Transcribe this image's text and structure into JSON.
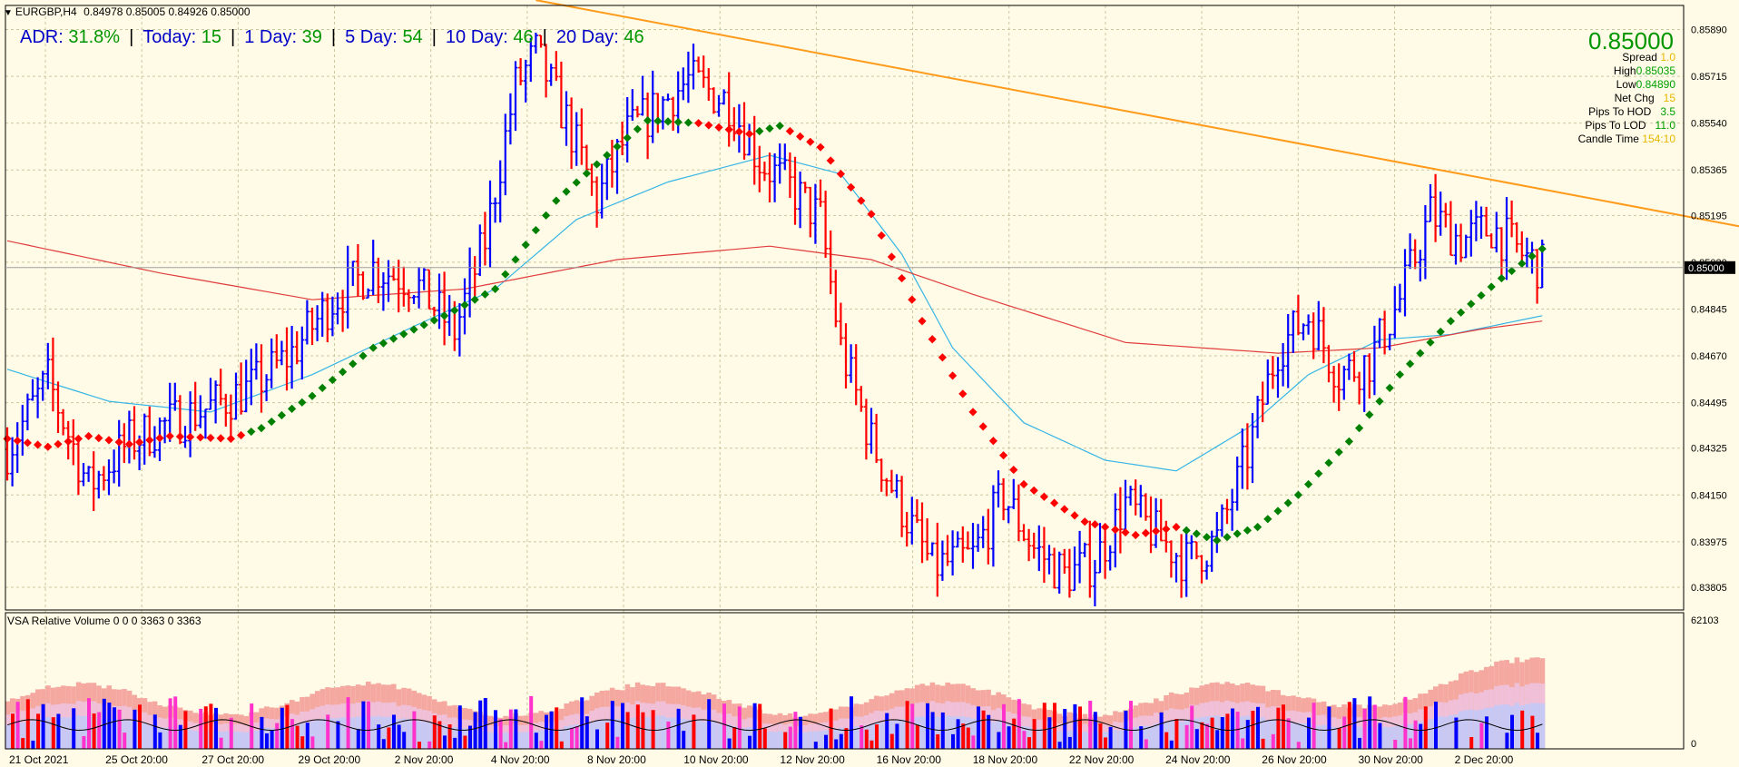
{
  "header": {
    "symbol": "EURGBP,H4",
    "ohlc": "0.84978 0.85005 0.84926 0.85000"
  },
  "adr_bar": {
    "adr_label": "ADR:",
    "adr_value": "31.8%",
    "today_label": "Today:",
    "today_value": "15",
    "d1_label": "1 Day:",
    "d1_value": "39",
    "d5_label": "5 Day:",
    "d5_value": "54",
    "d10_label": "10 Day:",
    "d10_value": "46",
    "d20_label": "20 Day:",
    "d20_value": "46",
    "separator": "|"
  },
  "info_panel": {
    "price": "0.85000",
    "spread_label": "Spread",
    "spread_value": "1.0",
    "high_label": "High",
    "high_value": "0.85035",
    "low_label": "Low",
    "low_value": "0.84890",
    "netchg_label": "Net Chg",
    "netchg_value": "15",
    "hod_label": "Pips To HOD",
    "hod_value": "3.5",
    "lod_label": "Pips To LOD",
    "lod_value": "11.0",
    "candle_label": "Candle Time",
    "candle_value": "154:10"
  },
  "colors": {
    "background": "#fffbe6",
    "up_bar": "#0000ff",
    "down_bar": "#ff0000",
    "trendline": "#ff9a1a",
    "ma_fast": "#36b5e6",
    "ma_slow": "#e03c3c",
    "dots_up": "#008000",
    "dots_down": "#ff0000",
    "grid": "#c8c8a0"
  },
  "chart_data": {
    "type": "bar",
    "title": "EURGBP,H4",
    "ylim": [
      0.8372,
      0.8598
    ],
    "y_ticks": [
      "0.85890",
      "0.85715",
      "0.85540",
      "0.85365",
      "0.85195",
      "0.85020",
      "0.84845",
      "0.84670",
      "0.84495",
      "0.84325",
      "0.84150",
      "0.83975",
      "0.83805"
    ],
    "current_price": "0.85000",
    "x_ticks": [
      "21 Oct 2021",
      "25 Oct 20:00",
      "27 Oct 20:00",
      "29 Oct 20:00",
      "2 Nov 20:00",
      "4 Nov 20:00",
      "8 Nov 20:00",
      "10 Nov 20:00",
      "12 Nov 20:00",
      "16 Nov 20:00",
      "18 Nov 20:00",
      "22 Nov 20:00",
      "24 Nov 20:00",
      "26 Nov 20:00",
      "30 Nov 20:00",
      "2 Dec 20:00"
    ],
    "price_anchors": [
      [
        0,
        0.8432
      ],
      [
        8,
        0.8458
      ],
      [
        16,
        0.8418
      ],
      [
        24,
        0.8435
      ],
      [
        32,
        0.8442
      ],
      [
        40,
        0.8448
      ],
      [
        48,
        0.8455
      ],
      [
        56,
        0.8468
      ],
      [
        64,
        0.8488
      ],
      [
        72,
        0.85
      ],
      [
        80,
        0.8495
      ],
      [
        88,
        0.8476
      ],
      [
        94,
        0.851
      ],
      [
        100,
        0.8568
      ],
      [
        104,
        0.858
      ],
      [
        110,
        0.8555
      ],
      [
        116,
        0.8525
      ],
      [
        122,
        0.855
      ],
      [
        128,
        0.856
      ],
      [
        134,
        0.857
      ],
      [
        142,
        0.8562
      ],
      [
        148,
        0.854
      ],
      [
        154,
        0.853
      ],
      [
        160,
        0.8518
      ],
      [
        164,
        0.847
      ],
      [
        170,
        0.8435
      ],
      [
        176,
        0.841
      ],
      [
        182,
        0.8388
      ],
      [
        190,
        0.8392
      ],
      [
        196,
        0.8415
      ],
      [
        202,
        0.8395
      ],
      [
        208,
        0.8385
      ],
      [
        214,
        0.839
      ],
      [
        220,
        0.8412
      ],
      [
        226,
        0.84
      ],
      [
        232,
        0.839
      ],
      [
        238,
        0.8398
      ],
      [
        244,
        0.843
      ],
      [
        250,
        0.847
      ],
      [
        256,
        0.8482
      ],
      [
        262,
        0.846
      ],
      [
        268,
        0.8465
      ],
      [
        274,
        0.8488
      ],
      [
        280,
        0.852
      ],
      [
        286,
        0.851
      ],
      [
        292,
        0.8515
      ],
      [
        298,
        0.8505
      ],
      [
        302,
        0.85
      ]
    ],
    "trendline": {
      "from": [
        104,
        0.86
      ],
      "to": [
        356,
        0.851
      ]
    },
    "series": [
      {
        "name": "MA fast",
        "points": [
          [
            0,
            0.8462
          ],
          [
            20,
            0.845
          ],
          [
            40,
            0.8446
          ],
          [
            60,
            0.846
          ],
          [
            80,
            0.8478
          ],
          [
            96,
            0.8492
          ],
          [
            112,
            0.8518
          ],
          [
            130,
            0.8532
          ],
          [
            150,
            0.8542
          ],
          [
            164,
            0.8535
          ],
          [
            176,
            0.8505
          ],
          [
            186,
            0.847
          ],
          [
            200,
            0.8442
          ],
          [
            216,
            0.8428
          ],
          [
            230,
            0.8424
          ],
          [
            244,
            0.844
          ],
          [
            256,
            0.846
          ],
          [
            270,
            0.8473
          ],
          [
            284,
            0.8475
          ],
          [
            302,
            0.8482
          ]
        ]
      },
      {
        "name": "MA slow",
        "points": [
          [
            0,
            0.851
          ],
          [
            30,
            0.8498
          ],
          [
            60,
            0.8488
          ],
          [
            90,
            0.8492
          ],
          [
            120,
            0.8503
          ],
          [
            150,
            0.8508
          ],
          [
            170,
            0.8503
          ],
          [
            190,
            0.849
          ],
          [
            220,
            0.8472
          ],
          [
            250,
            0.8468
          ],
          [
            270,
            0.847
          ],
          [
            290,
            0.8477
          ],
          [
            302,
            0.848
          ]
        ]
      },
      {
        "name": "Dots",
        "points": [
          [
            0,
            0.8436
          ],
          [
            8,
            0.8433
          ],
          [
            16,
            0.8437
          ],
          [
            24,
            0.8434
          ],
          [
            32,
            0.8437
          ],
          [
            44,
            0.8436
          ],
          [
            50,
            0.844
          ],
          [
            60,
            0.8452
          ],
          [
            72,
            0.847
          ],
          [
            86,
            0.8482
          ],
          [
            96,
            0.8492
          ],
          [
            108,
            0.8525
          ],
          [
            118,
            0.8542
          ],
          [
            126,
            0.8555
          ],
          [
            136,
            0.8554
          ],
          [
            146,
            0.855
          ],
          [
            152,
            0.8553
          ],
          [
            160,
            0.8545
          ],
          [
            170,
            0.852
          ],
          [
            180,
            0.848
          ],
          [
            190,
            0.8446
          ],
          [
            200,
            0.8419
          ],
          [
            212,
            0.8405
          ],
          [
            222,
            0.84
          ],
          [
            230,
            0.8403
          ],
          [
            238,
            0.8398
          ],
          [
            246,
            0.8403
          ],
          [
            254,
            0.8415
          ],
          [
            264,
            0.8435
          ],
          [
            274,
            0.846
          ],
          [
            284,
            0.848
          ],
          [
            294,
            0.8496
          ],
          [
            302,
            0.8507
          ]
        ]
      }
    ],
    "up_to_dots_index": [
      [
        0,
        0
      ],
      [
        20,
        0
      ],
      [
        48,
        1
      ],
      [
        82,
        1
      ],
      [
        120,
        1
      ],
      [
        136,
        0
      ],
      [
        148,
        1
      ],
      [
        154,
        0
      ],
      [
        186,
        0
      ],
      [
        212,
        0
      ],
      [
        232,
        1
      ],
      [
        260,
        1
      ],
      [
        302,
        1
      ]
    ],
    "volume": {
      "label": "VSA Relative Volume 0 0 0 3363 0 3363",
      "ylim": [
        0,
        62103
      ],
      "y_ticks": [
        "62103",
        "0"
      ]
    }
  }
}
